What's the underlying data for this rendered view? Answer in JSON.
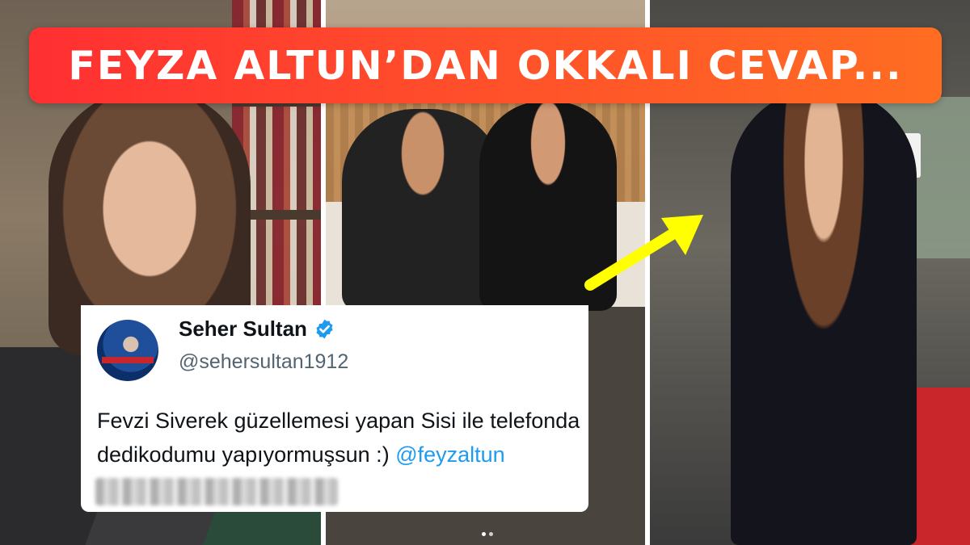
{
  "headline": {
    "title": "FEYZA ALTUN’DAN OKKALI CEVAP..."
  },
  "tweet": {
    "display_name": "Seher Sultan",
    "handle": "@sehersultan1912",
    "text_before_mention": "Fevzi Siverek güzellemesi yapan Sisi ile telefonda dedikodumu yapıyormuşsun :) ",
    "mention": "@feyzaltun",
    "verified": true,
    "avatar_icon": "avatar-tv-screenshot-icon",
    "verified_icon": "verified-badge-icon"
  },
  "carousel": {
    "dot_count": 2,
    "active_index": 0
  },
  "colors": {
    "banner_start": "#ff2f32",
    "banner_end": "#ff6d22",
    "verified_blue": "#1d9bf0",
    "mention_blue": "#1d9bf0",
    "arrow_yellow": "#ffff00"
  }
}
